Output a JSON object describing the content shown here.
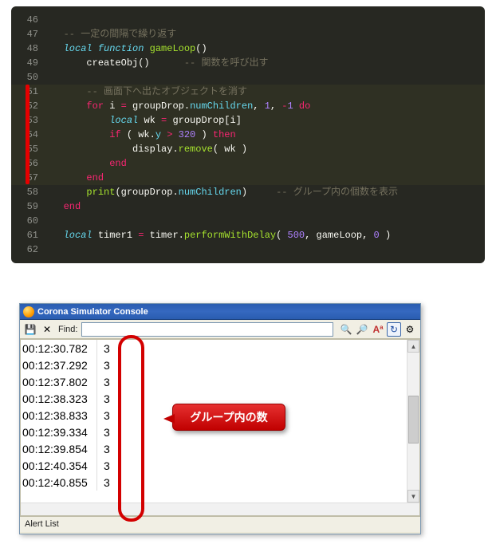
{
  "editor": {
    "lines": [
      {
        "num": "46",
        "html": ""
      },
      {
        "num": "47",
        "html": "   <span class='tok-comment'>-- 一定の間隔で繰り返す</span>"
      },
      {
        "num": "48",
        "html": "   <span class='tok-keyword'>local</span> <span class='tok-keyword'>function</span> <span class='tok-func'>gameLoop</span><span class='tok-paren'>()</span>"
      },
      {
        "num": "49",
        "html": "       <span class='tok-ident'>createObj</span><span class='tok-paren'>()</span>      <span class='tok-comment'>-- 関数を呼び出す</span>"
      },
      {
        "num": "50",
        "html": ""
      },
      {
        "num": "51",
        "html": "       <span class='tok-comment'>-- 画面下へ出たオブジェクトを消す</span>",
        "hl": true
      },
      {
        "num": "52",
        "html": "       <span class='tok-keyword2'>for</span> <span class='tok-ident'>i</span> <span class='tok-op'>=</span> <span class='tok-ident'>groupDrop</span>.<span class='tok-prop'>numChildren</span>, <span class='tok-num'>1</span>, <span class='tok-op'>-</span><span class='tok-num'>1</span> <span class='tok-keyword2'>do</span>",
        "hl": true
      },
      {
        "num": "53",
        "html": "           <span class='tok-keyword'>local</span> <span class='tok-ident'>wk</span> <span class='tok-op'>=</span> <span class='tok-ident'>groupDrop</span>[<span class='tok-ident'>i</span>]",
        "hl": true
      },
      {
        "num": "54",
        "html": "           <span class='tok-keyword2'>if</span> <span class='tok-paren'>(</span> <span class='tok-ident'>wk</span>.<span class='tok-prop'>y</span> <span class='tok-op'>></span> <span class='tok-num'>320</span> <span class='tok-paren'>)</span> <span class='tok-keyword2'>then</span>",
        "hl": true
      },
      {
        "num": "55",
        "html": "               <span class='tok-ident'>display</span>.<span class='tok-func'>remove</span><span class='tok-paren'>(</span> <span class='tok-ident'>wk</span> <span class='tok-paren'>)</span>",
        "hl": true
      },
      {
        "num": "56",
        "html": "           <span class='tok-keyword2'>end</span>",
        "hl": true
      },
      {
        "num": "57",
        "html": "       <span class='tok-keyword2'>end</span>",
        "hl": true
      },
      {
        "num": "58",
        "html": "       <span class='tok-func'>print</span><span class='tok-paren'>(</span><span class='tok-ident'>groupDrop</span>.<span class='tok-prop'>numChildren</span><span class='tok-paren'>)</span>     <span class='tok-comment'>-- グループ内の個数を表示</span>"
      },
      {
        "num": "59",
        "html": "   <span class='tok-keyword2'>end</span>"
      },
      {
        "num": "60",
        "html": ""
      },
      {
        "num": "61",
        "html": "   <span class='tok-keyword'>local</span> <span class='tok-ident'>timer1</span> <span class='tok-op'>=</span> <span class='tok-ident'>timer</span>.<span class='tok-func'>performWithDelay</span><span class='tok-paren'>(</span> <span class='tok-num'>500</span>, <span class='tok-ident'>gameLoop</span>, <span class='tok-num'>0</span> <span class='tok-paren'>)</span>"
      },
      {
        "num": "62",
        "html": ""
      }
    ]
  },
  "console": {
    "title": "Corona Simulator Console",
    "find_label": "Find:",
    "find_value": "",
    "alert_list": "Alert List",
    "rows": [
      {
        "ts": "00:12:30.782",
        "val": "3"
      },
      {
        "ts": "00:12:37.292",
        "val": "3"
      },
      {
        "ts": "00:12:37.802",
        "val": "3"
      },
      {
        "ts": "00:12:38.323",
        "val": "3"
      },
      {
        "ts": "00:12:38.833",
        "val": "3"
      },
      {
        "ts": "00:12:39.334",
        "val": "3"
      },
      {
        "ts": "00:12:39.854",
        "val": "3"
      },
      {
        "ts": "00:12:40.354",
        "val": "3"
      },
      {
        "ts": "00:12:40.855",
        "val": "3"
      }
    ]
  },
  "callout": {
    "text": "グループ内の数"
  },
  "icons": {
    "save": "💾",
    "close": "✕",
    "binoculars": "🔍",
    "findnext": "🔎",
    "aa": "Aª",
    "refresh": "↻",
    "gear": "⚙"
  }
}
